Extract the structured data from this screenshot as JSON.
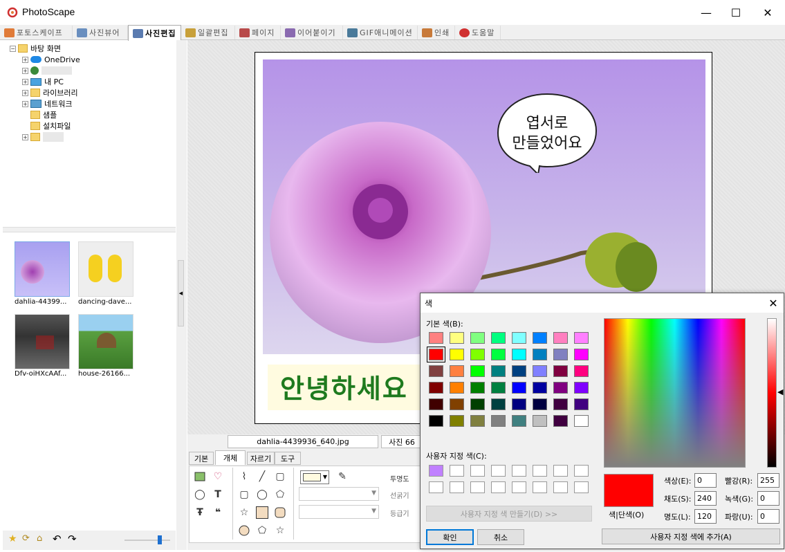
{
  "app": {
    "title": "PhotoScape"
  },
  "window_controls": {
    "minimize": "—",
    "maximize": "☐",
    "close": "✕"
  },
  "tabs": [
    {
      "label": "포토스케이프",
      "color": "#e07b39"
    },
    {
      "label": "사진뷰어",
      "color": "#6a8fbf"
    },
    {
      "label": "사진편집",
      "color": "#5a7bb0",
      "active": true
    },
    {
      "label": "일괄편집",
      "color": "#c8a03a"
    },
    {
      "label": "페이지",
      "color": "#b84a4a"
    },
    {
      "label": "이어붙이기",
      "color": "#8a6ab0"
    },
    {
      "label": "GIF애니메이션",
      "color": "#4a7a9a"
    },
    {
      "label": "인쇄",
      "color": "#c87a3a"
    },
    {
      "label": "도움말",
      "color": "#d03030"
    }
  ],
  "tree": {
    "root": "바탕 화면",
    "items": [
      "OneDrive",
      "",
      "내 PC",
      "라이브러리",
      "네트워크",
      "샘플",
      "설치파일",
      ""
    ]
  },
  "thumbnails": [
    {
      "label": "dahlia-44399..."
    },
    {
      "label": "dancing-dave..."
    },
    {
      "label": "Dfv-oiHXcAAf..."
    },
    {
      "label": "house-26166..."
    }
  ],
  "postcard": {
    "bubble_line1": "엽서로",
    "bubble_line2": "만들었어요",
    "greeting": "안녕하세요"
  },
  "status": {
    "filename": "dahlia-4439936_640.jpg",
    "size": "사진 66"
  },
  "bottom_tabs": [
    "기본",
    "개체",
    "자르기",
    "도구"
  ],
  "bottom_labels": {
    "opacity": "투명도",
    "line_width": "선굵기",
    "grade": "등급기"
  },
  "dialog": {
    "title": "색",
    "basic_colors_label": "기본 색(B):",
    "custom_colors_label": "사용자 지정 색(C):",
    "define_custom_button": "사용자 지정 색 만들기(D) >>",
    "ok_button": "확인",
    "cancel_button": "취소",
    "add_custom_button": "사용자 지정 색에 추가(A)",
    "solid_label": "색|단색(O)",
    "fields": {
      "hue_label": "색상(E):",
      "hue": "0",
      "sat_label": "채도(S):",
      "sat": "240",
      "lum_label": "명도(L):",
      "lum": "120",
      "red_label": "빨강(R):",
      "red": "255",
      "green_label": "녹색(G):",
      "green": "0",
      "blue_label": "파랑(U):",
      "blue": "0"
    },
    "basic_colors": [
      "#ff8080",
      "#ffff80",
      "#80ff80",
      "#00ff80",
      "#80ffff",
      "#0080ff",
      "#ff80c0",
      "#ff80ff",
      "#ff0000",
      "#ffff00",
      "#80ff00",
      "#00ff40",
      "#00ffff",
      "#0080c0",
      "#8080c0",
      "#ff00ff",
      "#804040",
      "#ff8040",
      "#00ff00",
      "#008080",
      "#004080",
      "#8080ff",
      "#800040",
      "#ff0080",
      "#800000",
      "#ff8000",
      "#008000",
      "#008040",
      "#0000ff",
      "#0000a0",
      "#800080",
      "#8000ff",
      "#400000",
      "#804000",
      "#004000",
      "#004040",
      "#000080",
      "#000040",
      "#400040",
      "#400080",
      "#000000",
      "#808000",
      "#808040",
      "#808080",
      "#408080",
      "#c0c0c0",
      "#400040",
      "#ffffff"
    ],
    "custom_first": "#c080ff",
    "current_color": "#ff0000"
  }
}
